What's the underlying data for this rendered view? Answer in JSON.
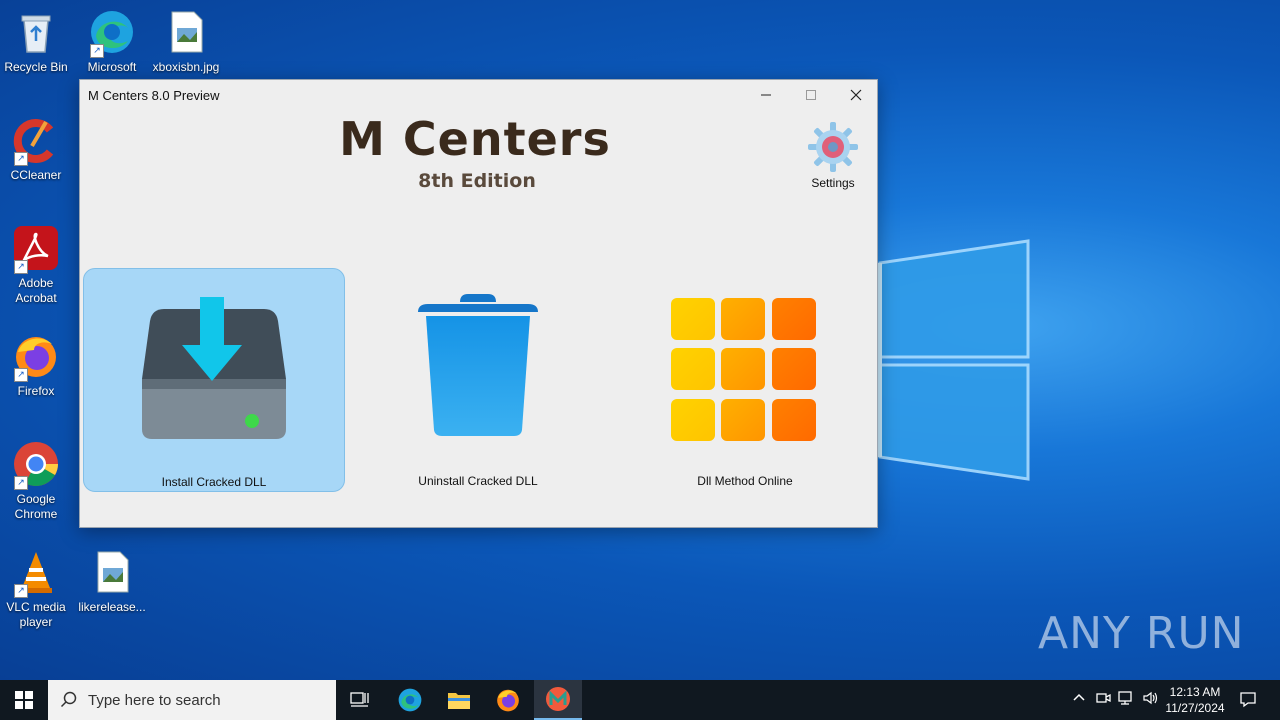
{
  "desktop": {
    "icons": [
      {
        "label": "Recycle Bin"
      },
      {
        "label": "Microsoft Edge"
      },
      {
        "label": "xboxisbn.jpg"
      },
      {
        "label": "CCleaner"
      },
      {
        "label": "Adobe Acrobat"
      },
      {
        "label": "Firefox"
      },
      {
        "label": "Google Chrome"
      },
      {
        "label": "VLC media player"
      },
      {
        "label": "likerelease..."
      }
    ],
    "watermark": "ANY RUN"
  },
  "window": {
    "title": "M Centers 8.0 Preview",
    "brand_title": "M Centers",
    "brand_subtitle": "8th Edition",
    "settings_label": "Settings",
    "tiles": [
      {
        "label": "Install Cracked DLL",
        "icon": "drive-download-icon",
        "selected": true
      },
      {
        "label": "Uninstall Cracked DLL",
        "icon": "trash-can-icon",
        "selected": false
      },
      {
        "label": "Dll Method Online",
        "icon": "grid-apps-icon",
        "selected": false
      }
    ]
  },
  "taskbar": {
    "search_placeholder": "Type here to search",
    "time": "12:13 AM",
    "date": "11/27/2024",
    "accent": "#76b9ed"
  }
}
